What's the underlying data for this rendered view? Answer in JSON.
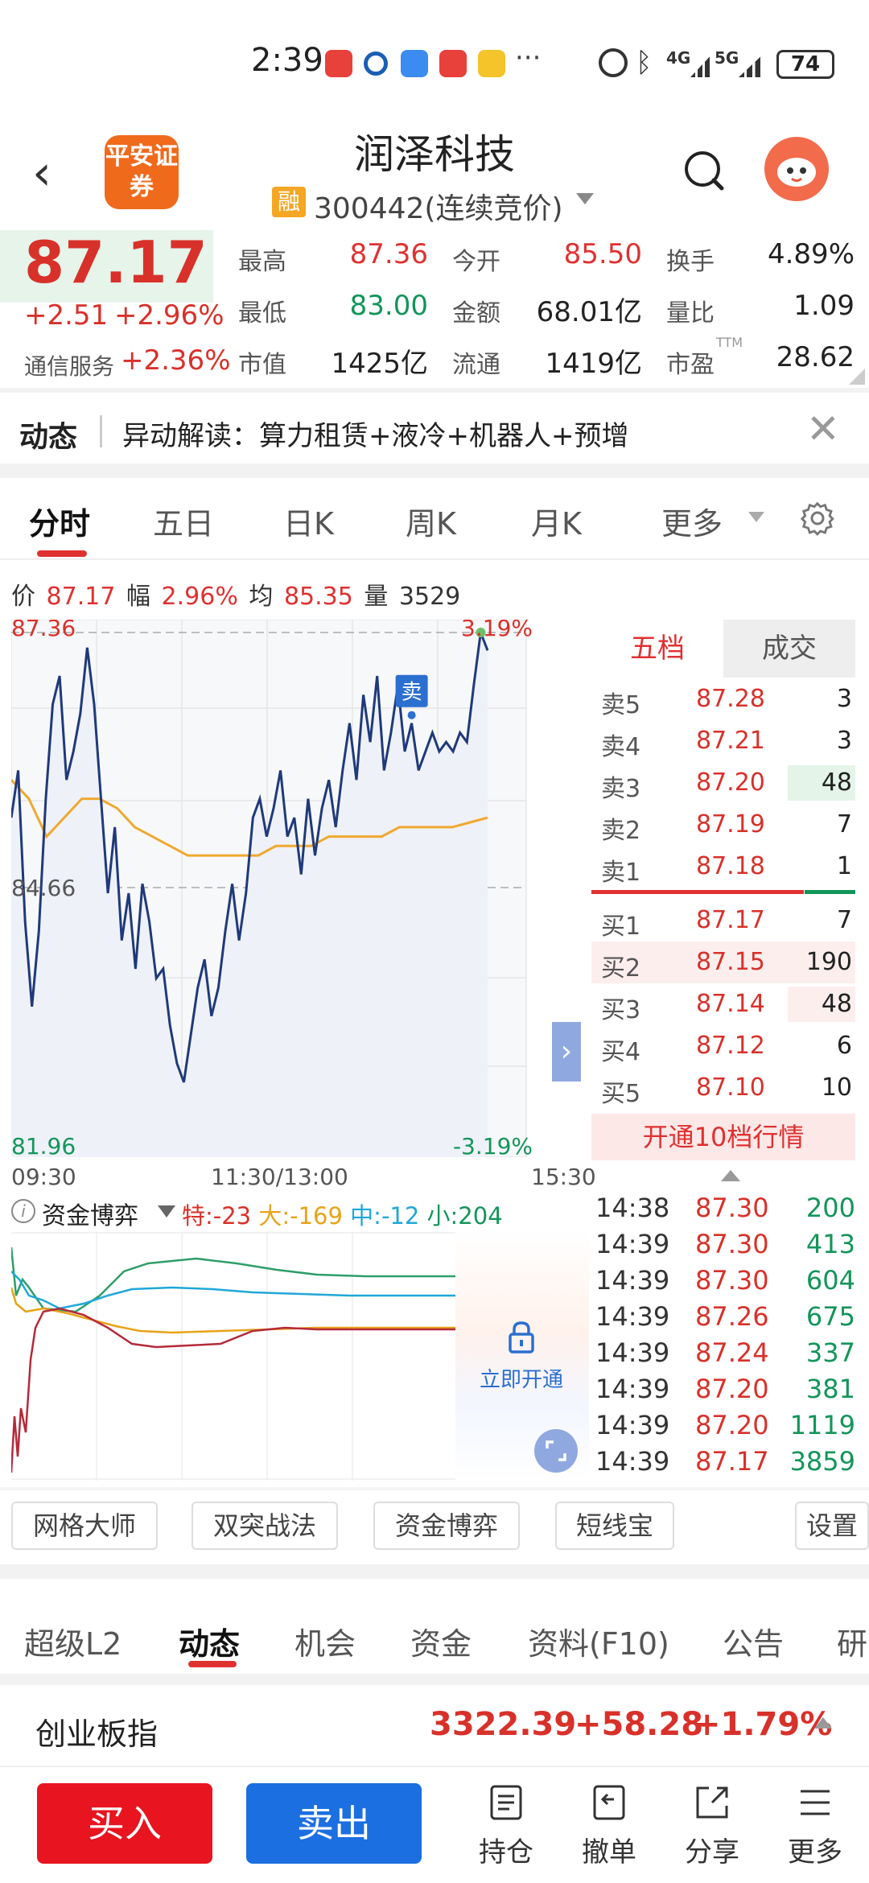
{
  "status_bar": {
    "time": "2:39",
    "battery": "74",
    "signal1": "4G",
    "signal2": "5G",
    "more": "···"
  },
  "header": {
    "back": "‹",
    "logo_text": "平安证券",
    "stock_name": "润泽科技",
    "rong_badge": "融",
    "code_line": "300442(连续竞价)"
  },
  "quote": {
    "price": "87.17",
    "change": "+2.51",
    "change_pct": "+2.96%",
    "sector_label": "通信服务",
    "sector_change": "+2.36%",
    "labels": {
      "high": "最高",
      "low": "最低",
      "mktcap": "市值",
      "open": "今开",
      "amount": "金额",
      "float": "流通",
      "turnover": "换手",
      "vol_ratio": "量比",
      "pe": "市盈"
    },
    "values": {
      "high": "87.36",
      "low": "83.00",
      "mktcap": "1425亿",
      "open": "85.50",
      "amount": "68.01亿",
      "float": "1419亿",
      "turnover": "4.89%",
      "vol_ratio": "1.09",
      "pe": "28.62"
    },
    "ttm": "TTM"
  },
  "news": {
    "tag": "动态",
    "text": "异动解读：算力租赁+液冷+机器人+预增"
  },
  "chart_tabs": [
    "分时",
    "五日",
    "日K",
    "周K",
    "月K",
    "更多"
  ],
  "info_row": {
    "price_label": "价",
    "price": "87.17",
    "amp_label": "幅",
    "amp": "2.96%",
    "avg_label": "均",
    "avg": "85.35",
    "vol_label": "量",
    "vol": "3529"
  },
  "chart_data": {
    "type": "line",
    "title": "",
    "y_left_ticks": [
      "87.36",
      "84.66",
      "81.96"
    ],
    "y_right_ticks": [
      "3.19%",
      "-3.19%"
    ],
    "x_ticks": [
      "09:30",
      "11:30/13:00",
      "15:30"
    ],
    "ylim": [
      81.96,
      87.36
    ],
    "prev_close": 84.66,
    "marker_label": "卖",
    "series": [
      {
        "name": "价",
        "color": "#1f3a7a",
        "values": [
          85.4,
          85.9,
          84.3,
          83.4,
          84.2,
          85.6,
          86.6,
          86.9,
          85.8,
          86.1,
          86.5,
          87.2,
          86.6,
          85.6,
          84.6,
          85.3,
          84.1,
          84.6,
          83.8,
          84.7,
          84.3,
          83.7,
          83.8,
          83.2,
          82.8,
          82.6,
          83.1,
          83.6,
          83.9,
          83.3,
          83.6,
          84.2,
          84.7,
          84.1,
          84.6,
          85.4,
          85.6,
          85.2,
          85.5,
          85.9,
          85.2,
          85.4,
          84.8,
          85.6,
          85.0,
          85.5,
          85.8,
          85.3,
          85.9,
          86.4,
          85.8,
          86.7,
          86.2,
          86.9,
          85.9,
          86.3,
          86.8,
          86.1,
          86.4,
          85.9,
          86.1,
          86.3,
          86.1,
          86.2,
          86.1,
          86.3,
          86.2,
          86.8,
          87.36,
          87.17
        ]
      },
      {
        "name": "均",
        "color": "#f0a830",
        "values": [
          85.8,
          85.6,
          85.2,
          85.4,
          85.6,
          85.6,
          85.5,
          85.3,
          85.2,
          85.1,
          85.0,
          85.0,
          85.0,
          85.0,
          85.0,
          85.1,
          85.1,
          85.1,
          85.2,
          85.2,
          85.2,
          85.2,
          85.3,
          85.3,
          85.3,
          85.3,
          85.35,
          85.4
        ]
      }
    ]
  },
  "order_book": {
    "tabs": [
      "五档",
      "成交"
    ],
    "asks": [
      {
        "label": "卖5",
        "price": "87.28",
        "vol": "3"
      },
      {
        "label": "卖4",
        "price": "87.21",
        "vol": "3"
      },
      {
        "label": "卖3",
        "price": "87.20",
        "vol": "48"
      },
      {
        "label": "卖2",
        "price": "87.19",
        "vol": "7"
      },
      {
        "label": "卖1",
        "price": "87.18",
        "vol": "1"
      }
    ],
    "bids": [
      {
        "label": "买1",
        "price": "87.17",
        "vol": "7"
      },
      {
        "label": "买2",
        "price": "87.15",
        "vol": "190"
      },
      {
        "label": "买3",
        "price": "87.14",
        "vol": "48"
      },
      {
        "label": "买4",
        "price": "87.12",
        "vol": "6"
      },
      {
        "label": "买5",
        "price": "87.10",
        "vol": "10"
      }
    ],
    "open_btn": "开通10档行情"
  },
  "ticks": [
    {
      "time": "14:38",
      "price": "87.30",
      "vol": "200"
    },
    {
      "time": "14:39",
      "price": "87.30",
      "vol": "413"
    },
    {
      "time": "14:39",
      "price": "87.30",
      "vol": "604"
    },
    {
      "time": "14:39",
      "price": "87.26",
      "vol": "675"
    },
    {
      "time": "14:39",
      "price": "87.24",
      "vol": "337"
    },
    {
      "time": "14:39",
      "price": "87.20",
      "vol": "381"
    },
    {
      "time": "14:39",
      "price": "87.20",
      "vol": "1119"
    },
    {
      "time": "14:39",
      "price": "87.17",
      "vol": "3859"
    }
  ],
  "sub_chart": {
    "info": "i",
    "title": "资金博弈",
    "te": "特:-23",
    "da": "大:-169",
    "zhong": "中:-12",
    "xiao": "小:204",
    "lock_text": "立即开通"
  },
  "tools": [
    "网格大师",
    "双突战法",
    "资金博弈",
    "短线宝",
    "设置"
  ],
  "bottom_tabs": [
    "超级L2",
    "动态",
    "机会",
    "资金",
    "资料(F10)",
    "公告",
    "研"
  ],
  "index": {
    "name": "创业板指",
    "value": "3322.39",
    "change": "+58.28",
    "pct": "+1.79%"
  },
  "actions": {
    "buy": "买入",
    "sell": "卖出",
    "hold": "持仓",
    "cancel": "撤单",
    "share": "分享",
    "more": "更多"
  }
}
